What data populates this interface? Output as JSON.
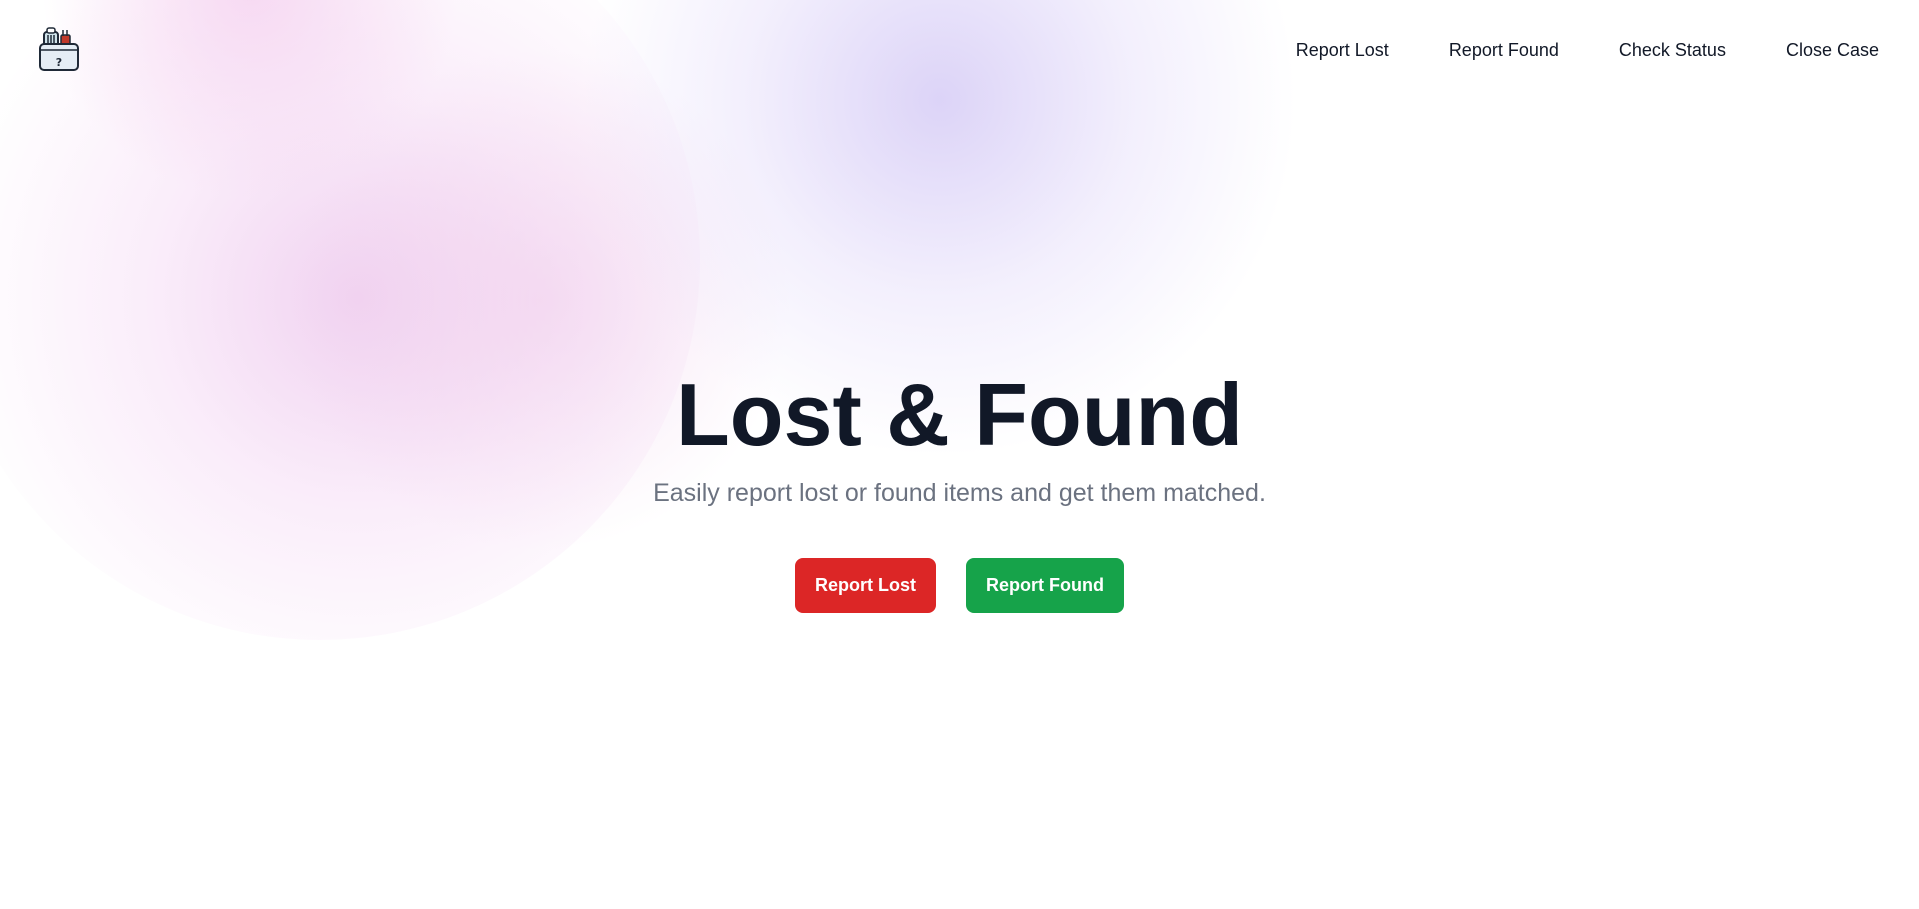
{
  "nav": {
    "logo_icon": "lost-and-found-box-icon",
    "links": [
      {
        "label": "Report Lost"
      },
      {
        "label": "Report Found"
      },
      {
        "label": "Check Status"
      },
      {
        "label": "Close Case"
      }
    ]
  },
  "hero": {
    "title": "Lost & Found",
    "subtitle": "Easily report lost or found items and get them matched.",
    "buttons": {
      "report_lost": "Report Lost",
      "report_found": "Report Found"
    }
  },
  "colors": {
    "report_lost_button": "#dc2626",
    "report_found_button": "#16a34a",
    "title_text": "#111827",
    "subtitle_text": "#6b7280",
    "background_blob_pink": "#ecc4ec",
    "background_blob_purple": "#d6ccf6"
  }
}
